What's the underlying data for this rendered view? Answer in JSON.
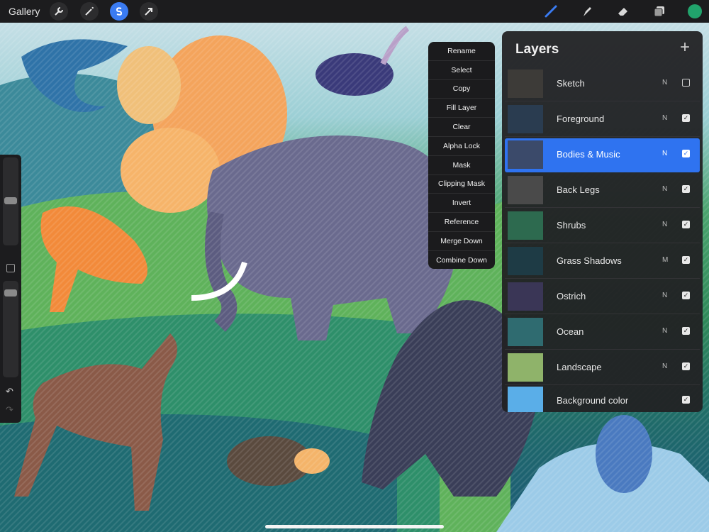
{
  "topbar": {
    "gallery_label": "Gallery",
    "left_tools": [
      {
        "icon": "wrench-icon",
        "name": "Actions"
      },
      {
        "icon": "magic-wand-icon",
        "name": "Adjustments"
      },
      {
        "icon": "selection-icon",
        "name": "Selection",
        "selected": true
      },
      {
        "icon": "transform-arrow-icon",
        "name": "Transform"
      }
    ],
    "right_tools": [
      {
        "icon": "brush-icon",
        "name": "Paint",
        "color": "#3a7bf2"
      },
      {
        "icon": "smudge-icon",
        "name": "Smudge"
      },
      {
        "icon": "eraser-icon",
        "name": "Erase"
      },
      {
        "icon": "layers-icon",
        "name": "Layers"
      }
    ],
    "current_color": "#21a36c"
  },
  "context_menu": {
    "items": [
      "Rename",
      "Select",
      "Copy",
      "Fill Layer",
      "Clear",
      "Alpha Lock",
      "Mask",
      "Clipping Mask",
      "Invert",
      "Reference",
      "Merge Down",
      "Combine Down"
    ]
  },
  "layers_panel": {
    "title": "Layers",
    "add_symbol": "+",
    "layers": [
      {
        "name": "Sketch",
        "blend": "N",
        "visible": false,
        "active": false,
        "thumb": "#3d3b38"
      },
      {
        "name": "Foreground",
        "blend": "N",
        "visible": true,
        "active": false,
        "thumb": "#2a3c50"
      },
      {
        "name": "Bodies & Music",
        "blend": "N",
        "visible": true,
        "active": true,
        "thumb": "#3b4a6a"
      },
      {
        "name": "Back Legs",
        "blend": "N",
        "visible": true,
        "active": false,
        "thumb": "#4a4a4a"
      },
      {
        "name": "Shrubs",
        "blend": "N",
        "visible": true,
        "active": false,
        "thumb": "#2d6a4f"
      },
      {
        "name": "Grass Shadows",
        "blend": "M",
        "visible": true,
        "active": false,
        "thumb": "#1e3b45"
      },
      {
        "name": "Ostrich",
        "blend": "N",
        "visible": true,
        "active": false,
        "thumb": "#3a3656"
      },
      {
        "name": "Ocean",
        "blend": "N",
        "visible": true,
        "active": false,
        "thumb": "#2f6b70"
      },
      {
        "name": "Landscape",
        "blend": "N",
        "visible": true,
        "active": false,
        "thumb": "#8fb36a"
      },
      {
        "name": "Background color",
        "blend": "",
        "visible": true,
        "active": false,
        "thumb": "#5aaee8"
      }
    ]
  },
  "colors": {
    "accent": "#2f73f0",
    "panel": "#222224",
    "toolbar": "#1c1c1e"
  }
}
